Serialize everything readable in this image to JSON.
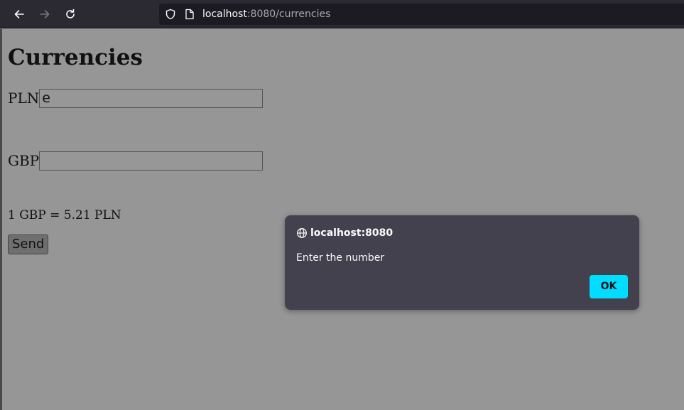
{
  "browser": {
    "url_host": "localhost",
    "url_path": ":8080/currencies",
    "icons": {
      "back": "arrow-left-icon",
      "forward": "arrow-right-icon",
      "reload": "reload-icon",
      "shield": "shield-icon",
      "page": "page-icon"
    }
  },
  "page": {
    "title": "Currencies",
    "pln_label": "PLN",
    "pln_value": "e",
    "gbp_label": "GBP",
    "gbp_value": "",
    "rate_text": "1 GBP = 5.21 PLN",
    "send_label": "Send"
  },
  "dialog": {
    "title": "localhost:8080",
    "message": "Enter the number",
    "ok_label": "OK",
    "icon": "globe-icon"
  },
  "colors": {
    "toolbar_bg": "#2b2a33",
    "urlbar_bg": "#1c1b22",
    "dialog_bg": "#42414d",
    "ok_accent": "#00ddff",
    "page_dimmed_bg": "#969696"
  }
}
